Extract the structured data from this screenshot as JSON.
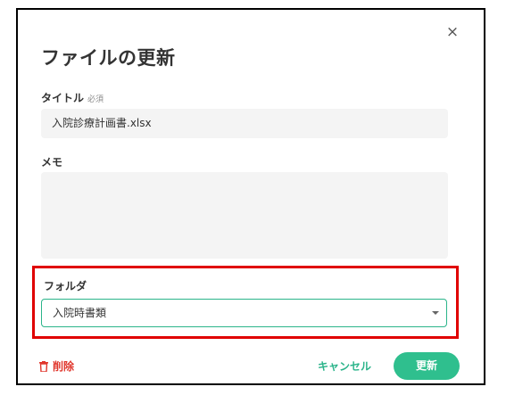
{
  "dialog": {
    "title": "ファイルの更新",
    "close_icon": "close-icon",
    "close_glyph": "×"
  },
  "form": {
    "title_label": "タイトル",
    "required_label": "必須",
    "title_value": "入院診療計画書.xlsx",
    "memo_label": "メモ",
    "memo_value": "",
    "folder_label": "フォルダ",
    "folder_value": "入院時書類"
  },
  "footer": {
    "delete_label": "削除",
    "delete_icon": "trash-icon",
    "cancel_label": "キャンセル",
    "update_label": "更新"
  },
  "colors": {
    "accent": "#2fbf8e",
    "danger": "#e0362c",
    "highlight": "#e00000"
  }
}
